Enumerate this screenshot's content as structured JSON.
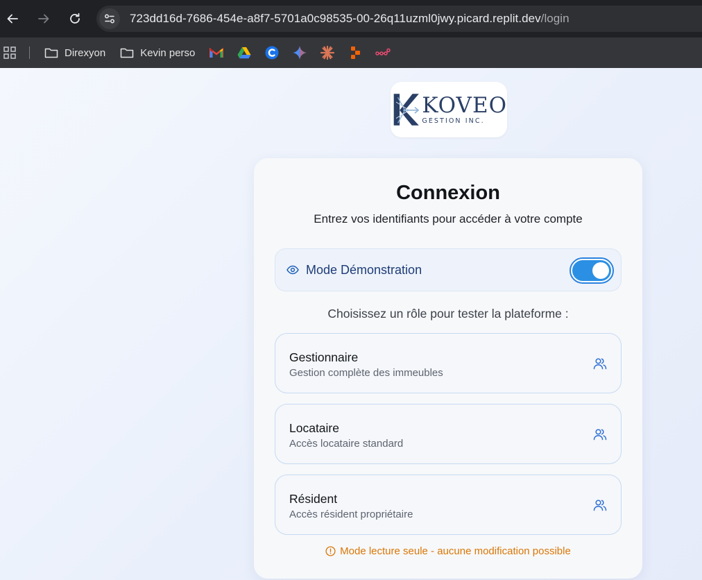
{
  "browser": {
    "url_host": "723dd16d-7686-454e-a8f7-5701a0c98535-00-26q11uzml0jwy.picard.replit.dev",
    "url_path": "/login"
  },
  "bookmarks": {
    "folders": [
      "Direxyon",
      "Kevin perso"
    ],
    "icons": [
      "gmail-icon",
      "google-drive-icon",
      "coda-icon",
      "gemini-icon",
      "claude-icon",
      "replit-icon",
      "n8n-icon"
    ]
  },
  "logo": {
    "name": "KOVEO",
    "subtitle": "GESTION INC."
  },
  "login": {
    "title": "Connexion",
    "subtitle": "Entrez vos identifiants pour accéder à votre compte",
    "demo_mode_label": "Mode Démonstration",
    "demo_mode_enabled": true,
    "role_prompt": "Choisissez un rôle pour tester la plateforme :",
    "roles": [
      {
        "title": "Gestionnaire",
        "description": "Gestion complète des immeubles"
      },
      {
        "title": "Locataire",
        "description": "Accès locataire standard"
      },
      {
        "title": "Résident",
        "description": "Accès résident propriétaire"
      }
    ],
    "readonly_notice": "Mode lecture seule - aucune modification possible"
  },
  "colors": {
    "accent": "#2b90e3",
    "demo_label": "#1e3c77",
    "warning": "#d97706",
    "brand": "#2a3f66"
  }
}
